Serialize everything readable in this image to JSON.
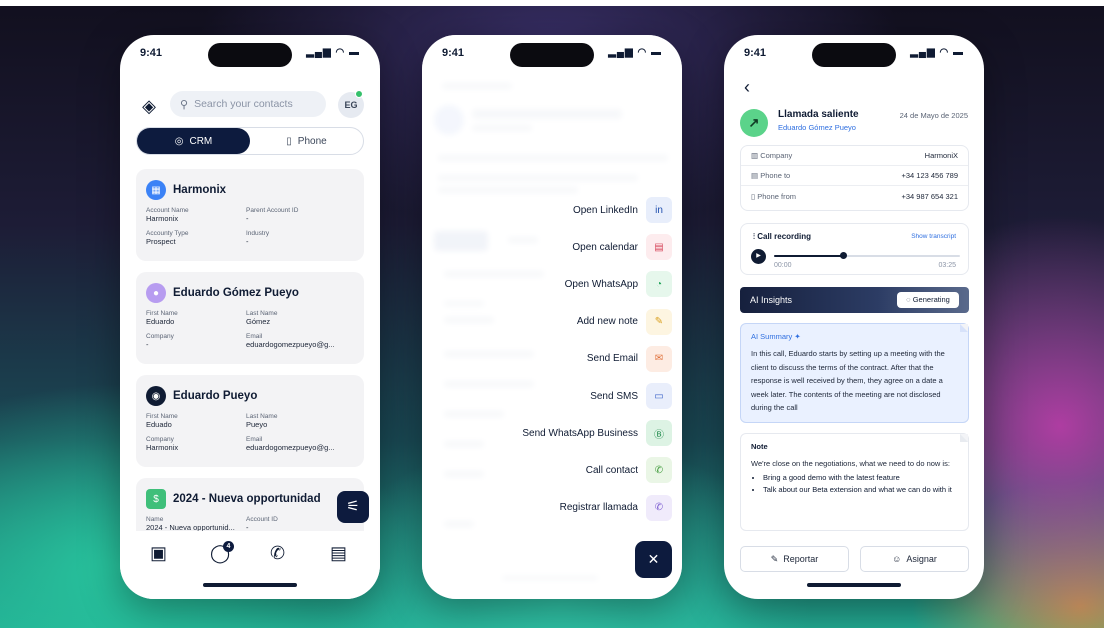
{
  "status": {
    "time": "9:41",
    "signal": "▂▄▆",
    "wifi": "◠",
    "battery": "▬"
  },
  "crm": {
    "search_placeholder": "Search your contacts",
    "avatar_initials": "EG",
    "segments": [
      {
        "label": "CRM",
        "icon": "target-icon",
        "glyph": "◎"
      },
      {
        "label": "Phone",
        "icon": "phone-device-icon",
        "glyph": "▯"
      }
    ],
    "cards": [
      {
        "title": "Harmonix",
        "icon_glyph": "▦",
        "fields": [
          {
            "label": "Account Name",
            "value": "Harmonix"
          },
          {
            "label": "Parent Account ID",
            "value": "-"
          },
          {
            "label": "Accounty Type",
            "value": "Prospect"
          },
          {
            "label": "Industry",
            "value": "-"
          }
        ]
      },
      {
        "title": "Eduardo Gómez Pueyo",
        "icon_glyph": "●",
        "fields": [
          {
            "label": "First Name",
            "value": "Eduardo"
          },
          {
            "label": "Last Name",
            "value": "Gómez"
          },
          {
            "label": "Company",
            "value": "-"
          },
          {
            "label": "Email",
            "value": "eduardogomezpueyo@g..."
          }
        ]
      },
      {
        "title": "Eduardo Pueyo",
        "icon_glyph": "◉",
        "fields": [
          {
            "label": "First Name",
            "value": "Eduado"
          },
          {
            "label": "Last Name",
            "value": "Pueyo"
          },
          {
            "label": "Company",
            "value": "Harmonix"
          },
          {
            "label": "Email",
            "value": "eduardogomezpueyo@g..."
          }
        ]
      },
      {
        "title": "2024 - Nueva opportunidad",
        "icon_glyph": "$",
        "fields": [
          {
            "label": "Name",
            "value": "2024 - Nueva opportunid..."
          },
          {
            "label": "Account ID",
            "value": "-"
          }
        ]
      }
    ],
    "filter_glyph": "⚟",
    "tabs": [
      {
        "name": "contacts-icon",
        "glyph": "▣"
      },
      {
        "name": "chat-icon",
        "glyph": "◯"
      },
      {
        "name": "phone-icon",
        "glyph": "✆"
      },
      {
        "name": "calendar-icon",
        "glyph": "▤"
      }
    ],
    "chat_badge": "4"
  },
  "actions": {
    "items": [
      {
        "label": "Open LinkedIn",
        "glyph": "in",
        "bg": "#e8eefb",
        "fg": "#1f4fae"
      },
      {
        "label": "Open calendar",
        "glyph": "▤",
        "bg": "#fdecee",
        "fg": "#d6455a"
      },
      {
        "label": "Open WhatsApp",
        "glyph": "◔",
        "bg": "#e6f7ec",
        "fg": "#22a45a"
      },
      {
        "label": "Add new note",
        "glyph": "✎",
        "bg": "#fdf5e1",
        "fg": "#d9a020"
      },
      {
        "label": "Send Email",
        "glyph": "✉",
        "bg": "#fdece3",
        "fg": "#e0703a"
      },
      {
        "label": "Send SMS",
        "glyph": "▭",
        "bg": "#e9eefb",
        "fg": "#3a63c9"
      },
      {
        "label": "Send WhatsApp Business",
        "glyph": "Ⓑ",
        "bg": "#ddf3e4",
        "fg": "#1f8a4b"
      },
      {
        "label": "Call contact",
        "glyph": "✆",
        "bg": "#eaf6e6",
        "fg": "#3f9a3a"
      },
      {
        "label": "Registrar llamada",
        "glyph": "✆",
        "bg": "#f0ebfb",
        "fg": "#7a5ad0"
      }
    ],
    "close_glyph": "✕"
  },
  "call": {
    "back_glyph": "‹",
    "direction_glyph": "↗",
    "title": "Llamada saliente",
    "person": "Eduardo Gómez Pueyo",
    "date": "24 de Mayo de 2025",
    "info": [
      {
        "label": "Company",
        "icon": "building-icon",
        "glyph": "▥",
        "value": "HarmoniX"
      },
      {
        "label": "Phone to",
        "icon": "phone-to-icon",
        "glyph": "▤",
        "value": "+34 123 456 789"
      },
      {
        "label": "Phone from",
        "icon": "phone-from-icon",
        "glyph": "▯",
        "value": "+34 987 654 321"
      }
    ],
    "recording": {
      "title": "Call recording",
      "link": "Show transcript",
      "start": "00:00",
      "end": "03:25",
      "progress": 0.37
    },
    "ai": {
      "label": "AI Insights",
      "button": "Generating"
    },
    "summary": {
      "title": "AI Summary",
      "text": "In this call, Eduardo starts by setting up a meeting with the client to discuss the terms of the contract. After that the response is well received by them, they agree on a date a week later. The contents of the meeting are not disclosed during the call"
    },
    "note": {
      "title": "Note",
      "text": "We're close on the negotiations, what we need to do now is:",
      "bullets": [
        "Bring a good demo with the latest feature",
        "Talk about our Beta extension and what we can do with it"
      ]
    },
    "buttons": [
      {
        "label": "Reportar",
        "glyph": "✎"
      },
      {
        "label": "Asignar",
        "glyph": "☺"
      }
    ]
  }
}
